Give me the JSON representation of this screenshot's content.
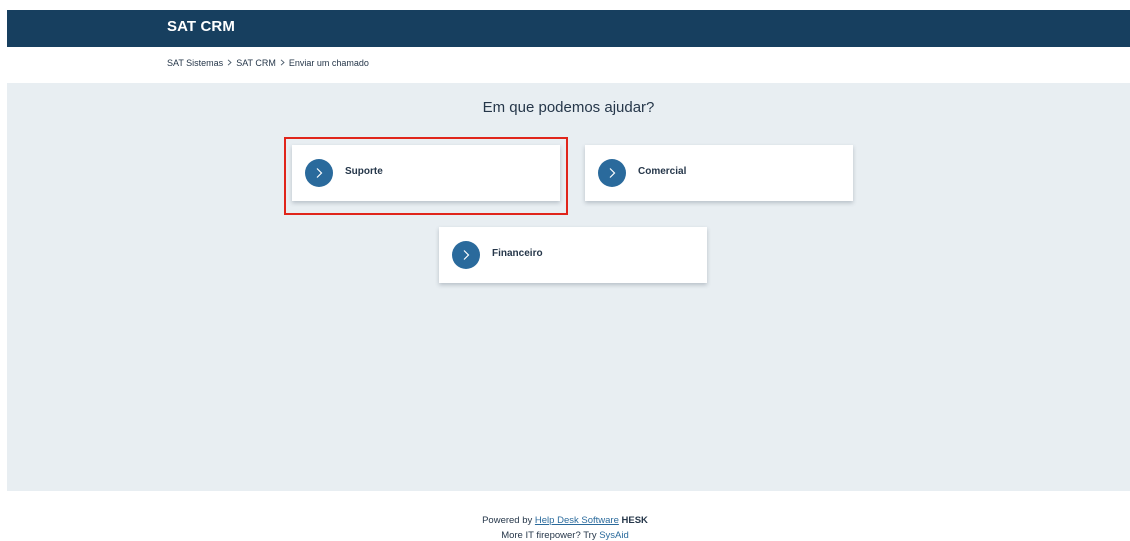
{
  "header": {
    "title": "SAT CRM",
    "background_color": "#173f5f"
  },
  "breadcrumb": {
    "items": [
      "SAT Sistemas",
      "SAT CRM",
      "Enviar um chamado"
    ]
  },
  "main": {
    "title": "Em que podemos ajudar?",
    "background_color": "#e8eef2",
    "categories": [
      {
        "label": "Suporte",
        "icon": "chevron-right-icon",
        "highlighted": true
      },
      {
        "label": "Comercial",
        "icon": "chevron-right-icon",
        "highlighted": false
      },
      {
        "label": "Financeiro",
        "icon": "chevron-right-icon",
        "highlighted": false
      }
    ],
    "accent_color": "#2a6a9c",
    "highlight_color": "#e0251b"
  },
  "footer": {
    "powered_prefix": "Powered by ",
    "powered_link": "Help Desk Software",
    "powered_brand": "HESK",
    "promo_prefix": "More IT firepower? Try ",
    "promo_link": "SysAid"
  }
}
